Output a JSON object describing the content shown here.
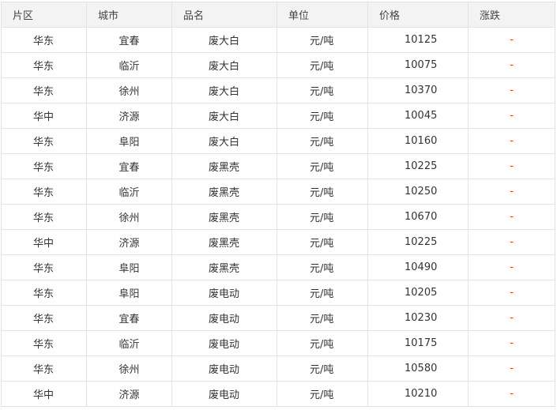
{
  "columns": [
    "片区",
    "城市",
    "品名",
    "单位",
    "价格",
    "涨跌"
  ],
  "rows": [
    {
      "region": "华东",
      "city": "宜春",
      "product": "废大白",
      "unit": "元/吨",
      "price": "10125",
      "change": "-"
    },
    {
      "region": "华东",
      "city": "临沂",
      "product": "废大白",
      "unit": "元/吨",
      "price": "10075",
      "change": "-"
    },
    {
      "region": "华东",
      "city": "徐州",
      "product": "废大白",
      "unit": "元/吨",
      "price": "10370",
      "change": "-"
    },
    {
      "region": "华中",
      "city": "济源",
      "product": "废大白",
      "unit": "元/吨",
      "price": "10045",
      "change": "-"
    },
    {
      "region": "华东",
      "city": "阜阳",
      "product": "废大白",
      "unit": "元/吨",
      "price": "10160",
      "change": "-"
    },
    {
      "region": "华东",
      "city": "宜春",
      "product": "废黑壳",
      "unit": "元/吨",
      "price": "10225",
      "change": "-"
    },
    {
      "region": "华东",
      "city": "临沂",
      "product": "废黑壳",
      "unit": "元/吨",
      "price": "10250",
      "change": "-"
    },
    {
      "region": "华东",
      "city": "徐州",
      "product": "废黑壳",
      "unit": "元/吨",
      "price": "10670",
      "change": "-"
    },
    {
      "region": "华中",
      "city": "济源",
      "product": "废黑壳",
      "unit": "元/吨",
      "price": "10225",
      "change": "-"
    },
    {
      "region": "华东",
      "city": "阜阳",
      "product": "废黑壳",
      "unit": "元/吨",
      "price": "10490",
      "change": "-"
    },
    {
      "region": "华东",
      "city": "阜阳",
      "product": "废电动",
      "unit": "元/吨",
      "price": "10205",
      "change": "-"
    },
    {
      "region": "华东",
      "city": "宜春",
      "product": "废电动",
      "unit": "元/吨",
      "price": "10230",
      "change": "-"
    },
    {
      "region": "华东",
      "city": "临沂",
      "product": "废电动",
      "unit": "元/吨",
      "price": "10175",
      "change": "-"
    },
    {
      "region": "华东",
      "city": "徐州",
      "product": "废电动",
      "unit": "元/吨",
      "price": "10580",
      "change": "-"
    },
    {
      "region": "华中",
      "city": "济源",
      "product": "废电动",
      "unit": "元/吨",
      "price": "10210",
      "change": "-"
    }
  ],
  "colors": {
    "header_bg": "#f3f3f3",
    "border": "#e3e3e3",
    "change": "#e0322b"
  }
}
